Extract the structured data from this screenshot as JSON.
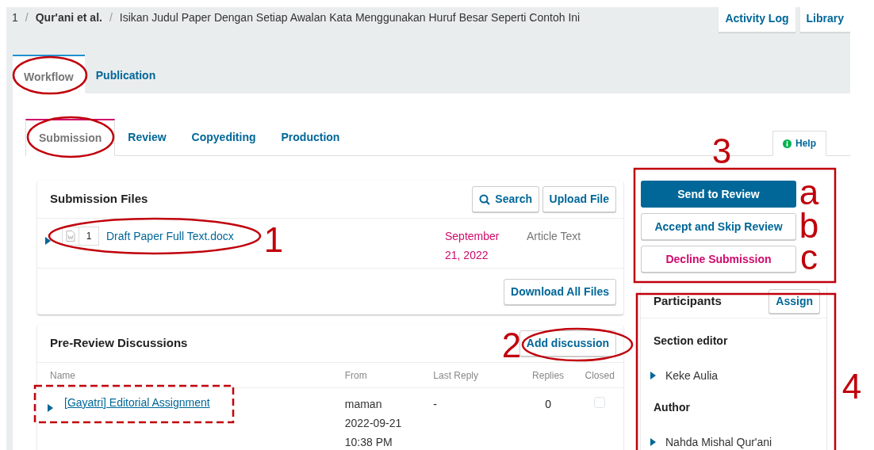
{
  "breadcrumb": {
    "id": "1",
    "separator": "/",
    "authors": "Qur'ani et al.",
    "title": "Isikan Judul Paper Dengan Setiap Awalan Kata Menggunakan Huruf Besar Seperti Contoh Ini"
  },
  "top_links": [
    "Activity Log",
    "Library"
  ],
  "main_tabs": [
    {
      "label": "Workflow",
      "selected": true
    },
    {
      "label": "Publication",
      "selected": false
    }
  ],
  "stage_tabs": [
    {
      "label": "Submission",
      "selected": true
    },
    {
      "label": "Review",
      "selected": false
    },
    {
      "label": "Copyediting",
      "selected": false
    },
    {
      "label": "Production",
      "selected": false
    }
  ],
  "help": {
    "label": "Help"
  },
  "submission_files": {
    "title": "Submission Files",
    "actions": [
      {
        "label": "Search",
        "kind": "search"
      },
      {
        "label": "Upload File",
        "kind": "plain"
      }
    ],
    "files": [
      {
        "number": "1",
        "name": "Draft Paper Full Text.docx",
        "date": "September 21, 2022",
        "genre": "Article Text"
      }
    ],
    "footer_action": "Download All Files"
  },
  "discussions": {
    "title": "Pre-Review Discussions",
    "action": "Add discussion",
    "columns": [
      "Name",
      "From",
      "Last Reply",
      "Replies",
      "Closed"
    ],
    "rows": [
      {
        "name": "[Gayatri] Editorial Assignment",
        "from": [
          "maman",
          "2022-09-21",
          "10:38 PM"
        ],
        "last_reply": "-",
        "replies": "0",
        "closed": false
      }
    ]
  },
  "decisions": [
    {
      "label": "Send to Review",
      "kind": "primary"
    },
    {
      "label": "Accept and Skip Review",
      "kind": "default"
    },
    {
      "label": "Decline Submission",
      "kind": "danger"
    }
  ],
  "participants": {
    "title": "Participants",
    "action": "Assign",
    "groups": [
      {
        "role": "Section editor",
        "people": [
          "Keke Aulia"
        ]
      },
      {
        "role": "Author",
        "people": [
          "Nahda Mishal Qur'ani"
        ]
      }
    ]
  },
  "annotations": [
    {
      "kind": "ellipse"
    },
    {
      "kind": "ellipse"
    },
    {
      "kind": "ellipse"
    },
    {
      "kind": "number",
      "text": "1"
    },
    {
      "kind": "number",
      "text": "2"
    },
    {
      "kind": "ellipse"
    },
    {
      "kind": "number",
      "text": "3"
    },
    {
      "kind": "frame"
    },
    {
      "kind": "number",
      "text": "a"
    },
    {
      "kind": "number",
      "text": "b"
    },
    {
      "kind": "number",
      "text": "c"
    },
    {
      "kind": "frame"
    },
    {
      "kind": "number",
      "text": "4"
    },
    {
      "kind": "dashed"
    }
  ]
}
